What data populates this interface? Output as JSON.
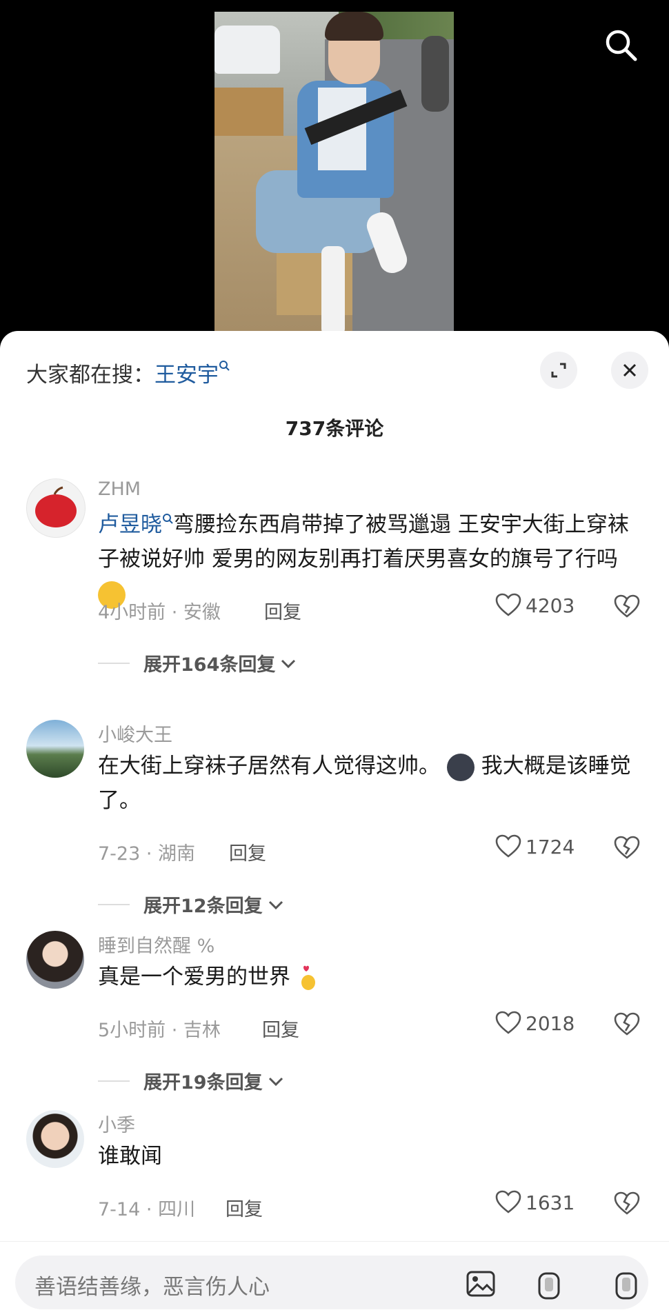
{
  "hot_search": {
    "prefix": "大家都在搜：",
    "keyword": "王安宇"
  },
  "comment_count": "737条评论",
  "comments": [
    {
      "username": "ZHM",
      "mention": "卢昱晓",
      "text": "弯腰捡东西肩带掉了被骂邋遢 王安宇大街上穿袜子被说好帅 爱男的网友别再打着厌男喜女的旗号了行吗",
      "emoji": "laughing-emoji",
      "time_location": "4小时前 · 安徽",
      "reply_label": "回复",
      "likes": "4203",
      "expand_label": "展开164条回复"
    },
    {
      "username": "小峻大王",
      "text": "在大街上穿袜子居然有人觉得这帅。",
      "text2": "我大概是该睡觉了。",
      "emoji": "dark-face-emoji",
      "time_location": "7-23 · 湖南",
      "reply_label": "回复",
      "likes": "1724",
      "expand_label": "展开12条回复"
    },
    {
      "username": "睡到自然醒 %",
      "text": "真是一个爱男的世界",
      "emoji": "finger-heart-emoji",
      "time_location": "5小时前 · 吉林",
      "reply_label": "回复",
      "likes": "2018",
      "expand_label": "展开19条回复"
    },
    {
      "username": "小季",
      "text": "谁敢闻",
      "time_location": "7-14 · 四川",
      "reply_label": "回复",
      "likes": "1631"
    }
  ],
  "input": {
    "placeholder": "善语结善缘，恶言伤人心"
  },
  "colors": {
    "link": "#1f5b9e",
    "muted": "#9a9a9a"
  }
}
